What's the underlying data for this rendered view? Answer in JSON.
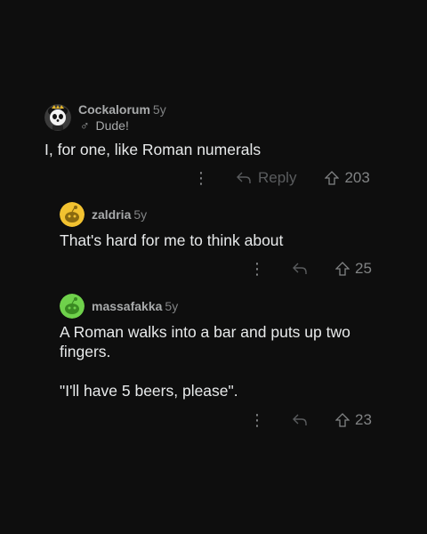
{
  "comments": [
    {
      "username": "Cockalorum",
      "age": "5y",
      "flair_symbol": "♂",
      "flair_text": "Dude!",
      "body": [
        "I, for one, like Roman numerals"
      ],
      "reply_label": "Reply",
      "votes": "203",
      "avatar_icon": "panda-avatar-icon"
    },
    {
      "username": "zaldria",
      "age": "5y",
      "body": [
        "That's hard for me to think about"
      ],
      "votes": "25",
      "avatar_icon": "yellow-snoo-avatar-icon"
    },
    {
      "username": "massafakka",
      "age": "5y",
      "body": [
        "A Roman walks into a bar and puts up two fingers.",
        "\"I'll have 5 beers, please\"."
      ],
      "votes": "23",
      "avatar_icon": "green-snoo-avatar-icon"
    }
  ],
  "colors": {
    "background": "#0e0e0e",
    "text": "#e8eaeb",
    "muted": "#818384",
    "avatar_yellow": "#f2c230",
    "avatar_green": "#6fd14b"
  }
}
